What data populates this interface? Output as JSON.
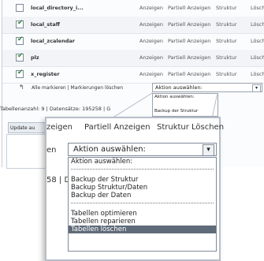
{
  "table_rows": [
    {
      "name": "local_directory_i...",
      "checked": false,
      "actions": [
        "Anzeigen",
        "Partiell Anzeigen",
        "Struktur",
        "Lösche"
      ]
    },
    {
      "name": "local_staff",
      "checked": true,
      "actions": [
        "Anzeigen",
        "Partiell Anzeigen",
        "Struktur",
        "Lösche"
      ]
    },
    {
      "name": "local_zcalendar",
      "checked": true,
      "actions": [
        "Anzeigen",
        "Partiell Anzeigen",
        "Struktur",
        "Lösche"
      ]
    },
    {
      "name": "plz",
      "checked": true,
      "actions": [
        "Anzeigen",
        "Partiell Anzeigen",
        "Struktur",
        "Lösche"
      ]
    },
    {
      "name": "x_register",
      "checked": true,
      "actions": [
        "Anzeigen",
        "Partiell Anzeigen",
        "Struktur",
        "Lösche"
      ]
    }
  ],
  "bottom": {
    "mark_text": "Alle markieren | Markierungen löschen",
    "select_value": "Aktion auswählen:",
    "list_items": [
      "Aktion auswählen:",
      "",
      "Backup der Struktur"
    ]
  },
  "footer": {
    "text": "Tabellenanzahl: 9 | Datensätze: 195258 | G"
  },
  "tab": {
    "label": "Update au"
  },
  "magnifier": {
    "header": [
      "zeigen",
      "Partiell Anzeigen",
      "Struktur",
      "Löschen"
    ],
    "left_labels": [
      "en",
      "58 | D"
    ],
    "select_value": "Aktion auswählen:",
    "options": [
      {
        "label": "Aktion auswählen:",
        "type": "item"
      },
      {
        "label": "",
        "type": "sep"
      },
      {
        "label": "Backup der Struktur",
        "type": "item"
      },
      {
        "label": "Backup Struktur/Daten",
        "type": "item"
      },
      {
        "label": "Backup der Daten",
        "type": "item"
      },
      {
        "label": "",
        "type": "sep"
      },
      {
        "label": "Tabellen optimieren",
        "type": "item"
      },
      {
        "label": "Tabellen reparieren",
        "type": "item"
      },
      {
        "label": "Tabellen löschen",
        "type": "item",
        "highlighted": true
      }
    ]
  }
}
